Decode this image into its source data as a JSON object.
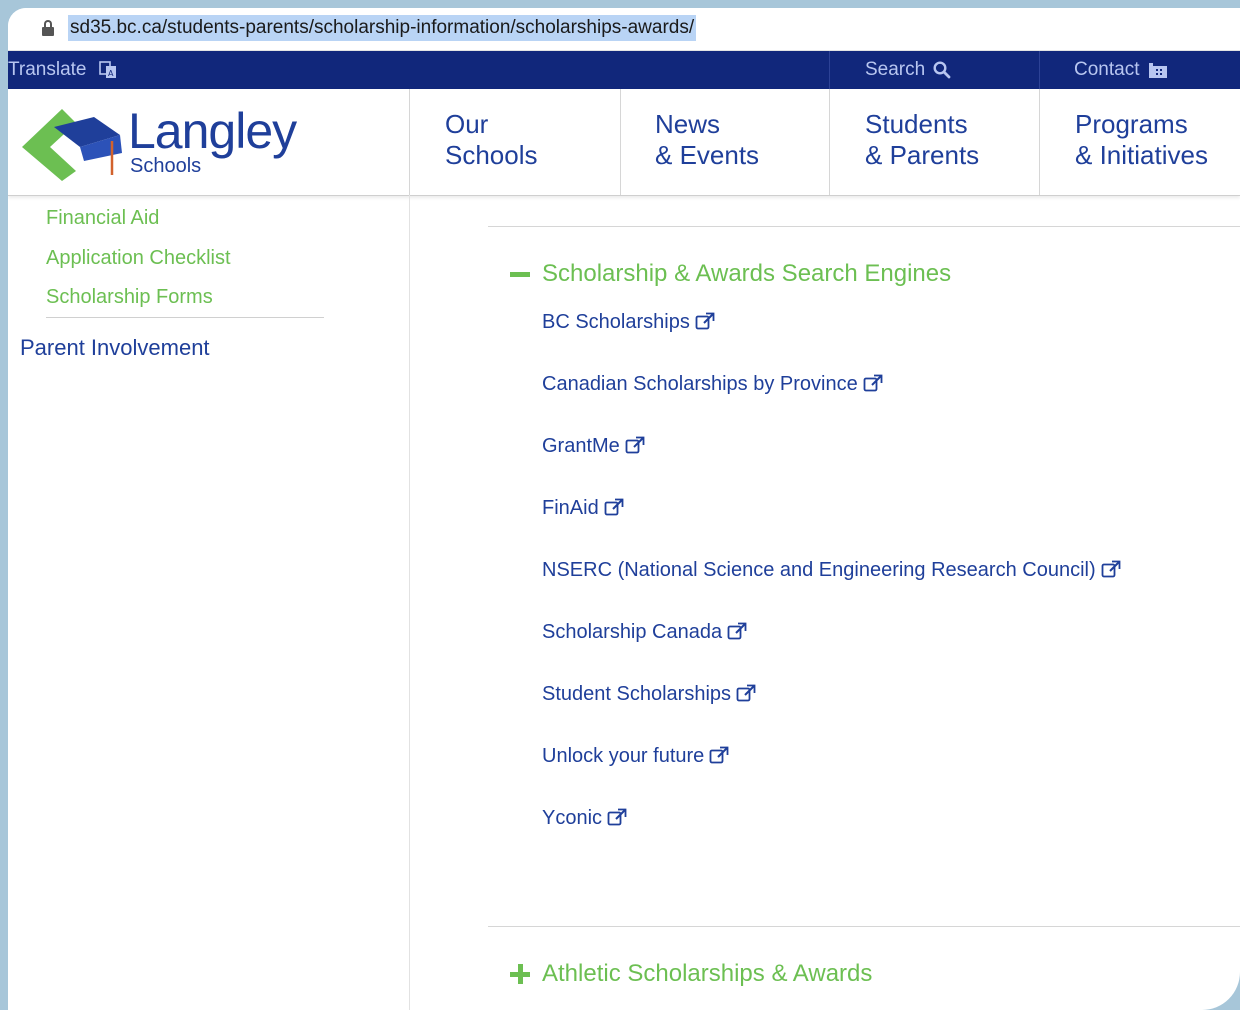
{
  "browser": {
    "url": "sd35.bc.ca/students-parents/scholarship-information/scholarships-awards/"
  },
  "utility_bar": {
    "translate": "Translate",
    "search": "Search",
    "contact": "Contact"
  },
  "logo": {
    "name": "Langley",
    "sub": "Schools"
  },
  "nav": [
    {
      "line1": "Our",
      "line2": "Schools"
    },
    {
      "line1": "News",
      "line2": "& Events"
    },
    {
      "line1": "Students",
      "line2": "& Parents"
    },
    {
      "line1": "Programs",
      "line2": "& Initiatives"
    }
  ],
  "sidebar": {
    "items": [
      "Financial Aid",
      "Application Checklist",
      "Scholarship Forms"
    ],
    "parent_involvement": "Parent Involvement"
  },
  "main": {
    "open_section": "Scholarship & Awards Search Engines",
    "links": [
      "BC Scholarships",
      "Canadian Scholarships by Province",
      "GrantMe",
      "FinAid",
      "NSERC (National Science and Engineering Research Council)",
      "Scholarship Canada",
      "Student Scholarships",
      "Unlock your future",
      "Yconic"
    ],
    "closed_section": "Athletic Scholarships & Awards"
  },
  "colors": {
    "navy": "#11277b",
    "link_blue": "#1f3f9a",
    "green": "#6cbf52"
  }
}
